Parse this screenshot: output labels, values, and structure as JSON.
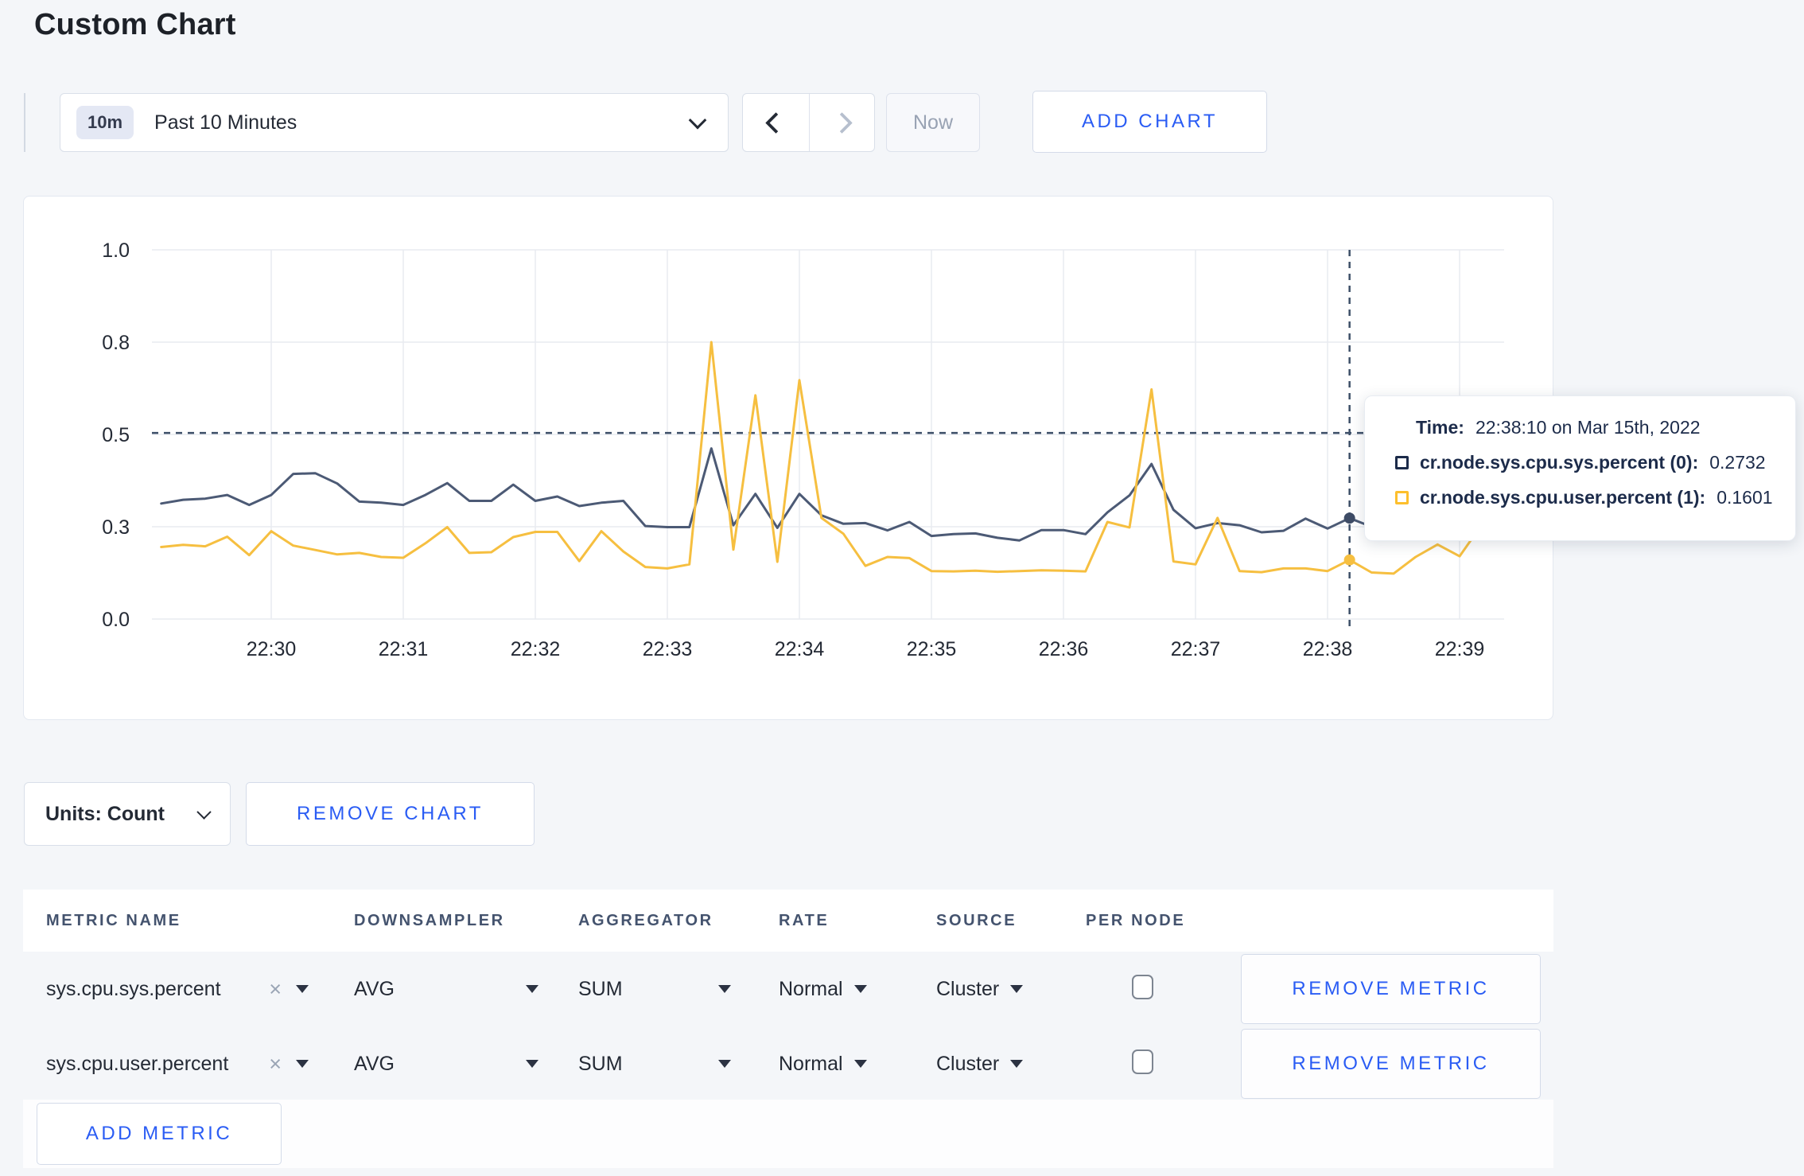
{
  "page": {
    "title": "Custom Chart"
  },
  "toolbar": {
    "range_badge": "10m",
    "range_label": "Past 10 Minutes",
    "now_label": "Now",
    "add_chart_label": "ADD CHART"
  },
  "chart": {
    "tooltip": {
      "time_label": "Time:",
      "time_value": "22:38:10 on Mar 15th, 2022",
      "series": [
        {
          "label": "cr.node.sys.cpu.sys.percent (0):",
          "value": "0.2732"
        },
        {
          "label": "cr.node.sys.cpu.user.percent (1):",
          "value": "0.1601"
        }
      ]
    }
  },
  "chart_data": {
    "type": "line",
    "title": "",
    "xlabel": "",
    "ylabel": "",
    "ylim": [
      0,
      1
    ],
    "grid": true,
    "x_start": "22:29:10",
    "x_step_seconds": 10,
    "x_ticks": [
      "22:30",
      "22:31",
      "22:32",
      "22:33",
      "22:34",
      "22:35",
      "22:36",
      "22:37",
      "22:38",
      "22:39"
    ],
    "y_ticks": [
      {
        "value": 0.0,
        "label": "0.0"
      },
      {
        "value": 0.25,
        "label": "0.3"
      },
      {
        "value": 0.5,
        "label": "0.5"
      },
      {
        "value": 0.75,
        "label": "0.8"
      },
      {
        "value": 1.0,
        "label": "1.0"
      }
    ],
    "crosshair": {
      "index": 54,
      "time": "22:38:10",
      "h_value": 0.504
    },
    "series": [
      {
        "name": "cr.node.sys.cpu.sys.percent",
        "color": "#4c5a75",
        "swatch": "#1c2b4a",
        "values": [
          0.313,
          0.323,
          0.326,
          0.336,
          0.309,
          0.336,
          0.393,
          0.395,
          0.367,
          0.318,
          0.315,
          0.309,
          0.336,
          0.368,
          0.32,
          0.32,
          0.364,
          0.32,
          0.332,
          0.306,
          0.315,
          0.32,
          0.252,
          0.249,
          0.249,
          0.462,
          0.254,
          0.339,
          0.247,
          0.339,
          0.281,
          0.258,
          0.26,
          0.24,
          0.263,
          0.225,
          0.23,
          0.232,
          0.22,
          0.213,
          0.241,
          0.241,
          0.23,
          0.289,
          0.335,
          0.42,
          0.296,
          0.246,
          0.26,
          0.254,
          0.235,
          0.239,
          0.272,
          0.245,
          0.2732,
          0.25,
          0.255,
          0.26,
          0.255,
          0.25,
          0.298
        ]
      },
      {
        "name": "cr.node.sys.cpu.user.percent",
        "color": "#f6bf40",
        "swatch": "#fdbf2d",
        "values": [
          0.195,
          0.201,
          0.197,
          0.223,
          0.173,
          0.238,
          0.199,
          0.187,
          0.175,
          0.179,
          0.168,
          0.166,
          0.205,
          0.249,
          0.179,
          0.181,
          0.222,
          0.236,
          0.236,
          0.157,
          0.238,
          0.183,
          0.141,
          0.137,
          0.148,
          0.75,
          0.188,
          0.606,
          0.155,
          0.647,
          0.274,
          0.231,
          0.144,
          0.168,
          0.165,
          0.13,
          0.129,
          0.131,
          0.128,
          0.13,
          0.132,
          0.131,
          0.129,
          0.263,
          0.248,
          0.622,
          0.156,
          0.148,
          0.274,
          0.13,
          0.127,
          0.137,
          0.137,
          0.13,
          0.1601,
          0.126,
          0.123,
          0.168,
          0.202,
          0.17,
          0.255
        ]
      }
    ]
  },
  "chart_controls": {
    "units_label": "Units: Count",
    "remove_chart_label": "REMOVE CHART"
  },
  "metrics_table": {
    "clear_glyph": "×",
    "headers": [
      "METRIC NAME",
      "DOWNSAMPLER",
      "AGGREGATOR",
      "RATE",
      "SOURCE",
      "PER NODE"
    ],
    "rows": [
      {
        "metric": "sys.cpu.sys.percent",
        "downsampler": "AVG",
        "aggregator": "SUM",
        "rate": "Normal",
        "source": "Cluster",
        "per_node": false,
        "remove_label": "REMOVE METRIC"
      },
      {
        "metric": "sys.cpu.user.percent",
        "downsampler": "AVG",
        "aggregator": "SUM",
        "rate": "Normal",
        "source": "Cluster",
        "per_node": false,
        "remove_label": "REMOVE METRIC"
      }
    ],
    "add_metric_label": "ADD METRIC"
  }
}
